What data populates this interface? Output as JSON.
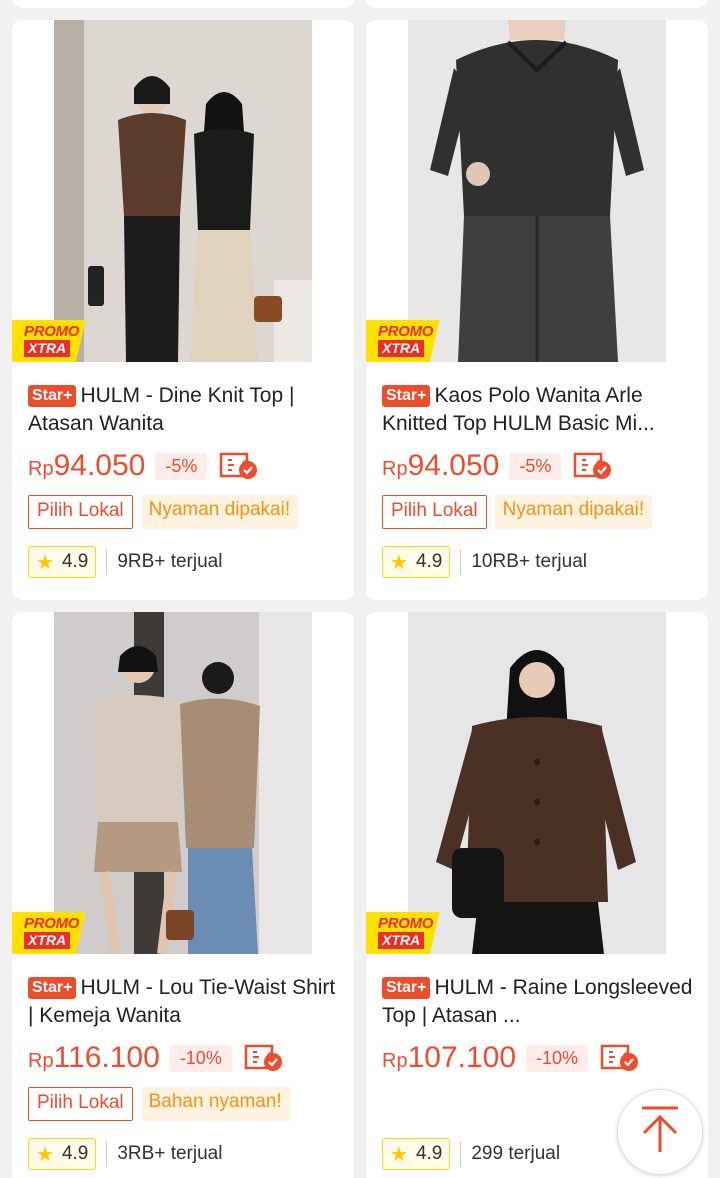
{
  "products": [
    {
      "badge": "Star+",
      "title": "HULM - Dine Knit Top | Atasan Wanita",
      "currency": "Rp",
      "price": "94.050",
      "discount": "-5%",
      "tag_red": "Pilih Lokal",
      "tag_orange": "Nyaman dipakai!",
      "rating": "4.9",
      "sold": "9RB+ terjual",
      "promo_line1": "PROMO",
      "promo_line2": "XTRA"
    },
    {
      "badge": "Star+",
      "title": "Kaos Polo Wanita Arle Knitted Top HULM Basic Mi...",
      "currency": "Rp",
      "price": "94.050",
      "discount": "-5%",
      "tag_red": "Pilih Lokal",
      "tag_orange": "Nyaman dipakai!",
      "rating": "4.9",
      "sold": "10RB+ terjual",
      "promo_line1": "PROMO",
      "promo_line2": "XTRA"
    },
    {
      "badge": "Star+",
      "title": "HULM - Lou Tie-Waist Shirt | Kemeja Wanita",
      "currency": "Rp",
      "price": "116.100",
      "discount": "-10%",
      "tag_red": "Pilih Lokal",
      "tag_orange": "Bahan nyaman!",
      "rating": "4.9",
      "sold": "3RB+ terjual",
      "promo_line1": "PROMO",
      "promo_line2": "XTRA"
    },
    {
      "badge": "Star+",
      "title": "HULM - Raine Longsleeved Top | Atasan ...",
      "currency": "Rp",
      "price": "107.100",
      "discount": "-10%",
      "rating": "4.9",
      "sold": "299 terjual",
      "promo_line1": "PROMO",
      "promo_line2": "XTRA"
    }
  ],
  "colors": {
    "accent": "#ee4d2d",
    "promo_yellow": "#ffe100",
    "tag_orange": "#f69113",
    "rating_border": "#ffd21e"
  }
}
